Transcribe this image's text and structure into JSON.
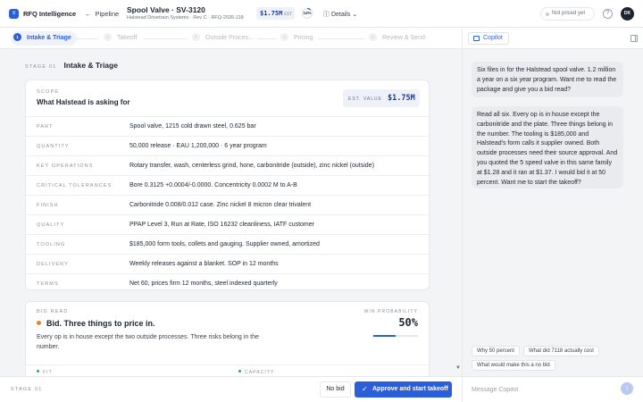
{
  "header": {
    "logo_glyph": "≡",
    "brand": "RFQ Intelligence",
    "back_label": "Pipeline",
    "title": "Spool Valve · SV-3120",
    "subtitle": "Halstead Drivetrain Systems · Rev C · RFQ-2026-118",
    "est_value": "$1.75M",
    "est_label": "EST",
    "win_pct": "12%",
    "win_fraction": 0.12,
    "details_label": "Details",
    "status": "Not priced yet",
    "help_glyph": "?",
    "avatar": "DK"
  },
  "steps": [
    {
      "num": "1",
      "label": "Intake & Triage"
    },
    {
      "num": "2",
      "label": "Takeoff"
    },
    {
      "num": "3",
      "label": "Outside Proces..."
    },
    {
      "num": "4",
      "label": "Pricing"
    },
    {
      "num": "5",
      "label": "Review & Send"
    }
  ],
  "stage": {
    "label": "STAGE 01",
    "name": "Intake & Triage"
  },
  "scope": {
    "kicker": "SCOPE",
    "heading": "What Halstead is asking for",
    "est_label": "EST. VALUE",
    "est_value": "$1.75M",
    "rows": [
      {
        "key": "PART",
        "value": "Spool valve, 1215 cold drawn steel, 0.625 bar"
      },
      {
        "key": "QUANTITY",
        "value": "50,000 release · EAU 1,200,000 · 6 year program"
      },
      {
        "key": "KEY OPERATIONS",
        "value": "Rotary transfer, wash, centerless grind, hone, carbonitride (outside), zinc nickel (outside)"
      },
      {
        "key": "CRITICAL TOLERANCES",
        "value": "Bore 0.3125 +0.0004/-0.0000. Concentricity 0.0002 M to A-B"
      },
      {
        "key": "FINISH",
        "value": "Carbonitride 0.008/0.012 case. Zinc nickel 8 micron clear trivalent"
      },
      {
        "key": "QUALITY",
        "value": "PPAP Level 3, Run at Rate, ISO 16232 cleanliness, IATF customer"
      },
      {
        "key": "TOOLING",
        "value": "$185,000 form tools, collets and gauging. Supplier owned, amortized"
      },
      {
        "key": "DELIVERY",
        "value": "Weekly releases against a blanket. SOP in 12 months"
      },
      {
        "key": "TERMS",
        "value": "Net 60, prices firm 12 months, steel indexed quarterly"
      }
    ]
  },
  "bid": {
    "kicker": "BID READ",
    "title": "Bid. Three things to price in.",
    "desc": "Every op is in house except the two outside processes. Three risks belong in the number.",
    "win_label": "WIN PROBABILITY",
    "win_value": "50%",
    "win_fraction": 0.5,
    "fit_label": "FIT",
    "capacity_label": "CAPACITY"
  },
  "footer": {
    "stage": "STAGE 01",
    "no_bid": "No bid",
    "approve": "Approve and start takeoff"
  },
  "copilot": {
    "tab": "Copilot",
    "messages": [
      "Six files in for the Halstead spool valve. 1.2 million a year on a six year program. Want me to read the package and give you a bid read?",
      "Read all six. Every op is in house except the carbonitride and the plate. Three things belong in the number. The tooling is $185,000 and Halstead's form calls it supplier owned. Both outside processes need their source approval. And you quoted the 5 speed valve in this same family at $1.28 and it ran at $1.37. I would bid it at 50 percent. Want me to start the takeoff?"
    ],
    "chips": [
      "Why 50 percent",
      "What did 7118 actually cost",
      "What would make this a no bid"
    ],
    "input_placeholder": "Message Copilot",
    "send_glyph": "↑"
  }
}
